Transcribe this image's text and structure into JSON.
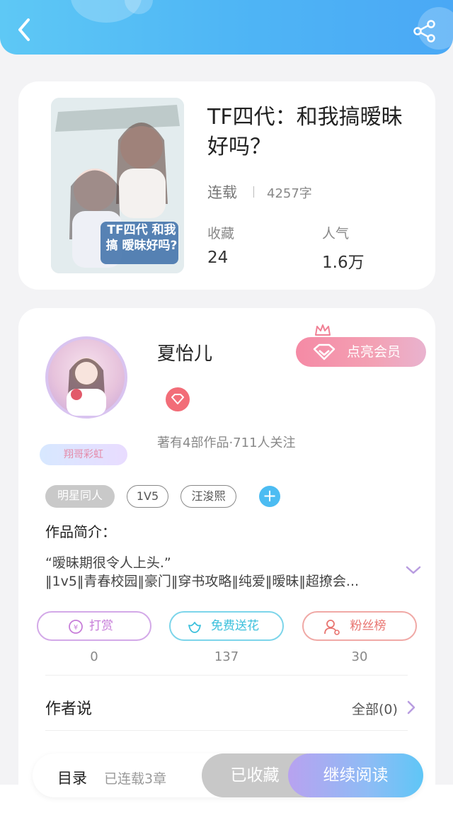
{
  "book": {
    "title": "TF四代：和我搞暧昧好吗？",
    "status": "连载",
    "word_count": "4257字",
    "collect_label": "收藏",
    "collect_value": "24",
    "popularity_label": "人气",
    "popularity_value": "1.6万",
    "cover_text": "TF四代 和我搞 暧昧好吗?"
  },
  "author": {
    "name": "夏怡儿",
    "badge": "翔哥彩虹",
    "vip_button": "点亮会员",
    "works_info": "著有4部作品·711人关注"
  },
  "tags": [
    "明星同人",
    "1V5",
    "汪浚熙"
  ],
  "intro": {
    "label": "作品简介：",
    "line1": "“暧昧期很令人上头.”",
    "line2": "‖1v5‖青春校园‖豪门‖穿书攻略‖纯爱‖暧昧‖超撩会..."
  },
  "actions": [
    {
      "label": "打赏",
      "count": "0"
    },
    {
      "label": "免费送花",
      "count": "137"
    },
    {
      "label": "粉丝榜",
      "count": "30"
    }
  ],
  "author_says": {
    "label": "作者说",
    "all": "全部(0)"
  },
  "bottom": {
    "toc": "目录",
    "chapters": "已连载3章",
    "collected": "已收藏",
    "continue": "继续阅读"
  },
  "colors": {
    "accent_blue": "#4cbcf2",
    "tip_purple": "#c77dd9",
    "flower_cyan": "#4cc6e0",
    "fans_red": "#e87470",
    "vip_pink": "#f58aa5"
  }
}
